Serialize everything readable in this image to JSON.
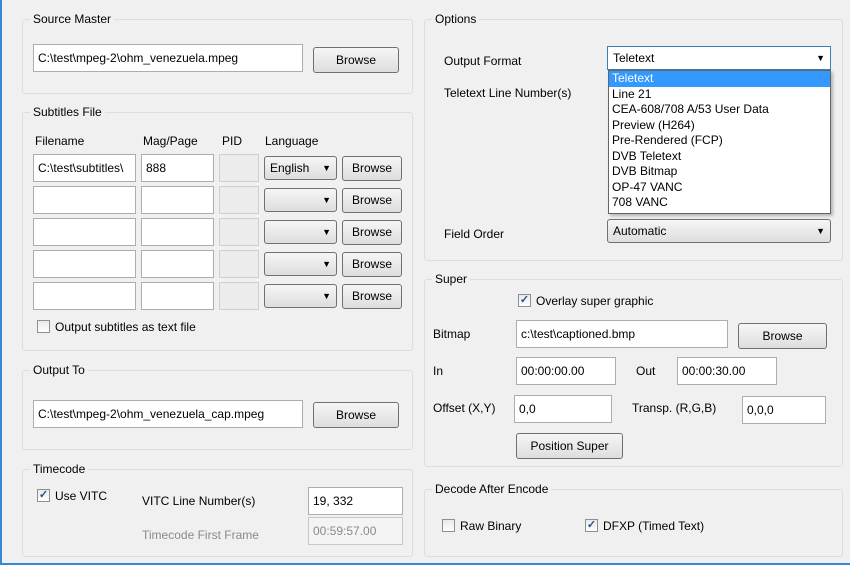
{
  "source_master": {
    "title": "Source Master",
    "path": "C:\\test\\mpeg-2\\ohm_venezuela.mpeg",
    "browse": "Browse"
  },
  "subtitles": {
    "title": "Subtitles File",
    "headers": {
      "filename": "Filename",
      "mag_page": "Mag/Page",
      "pid": "PID",
      "language": "Language"
    },
    "rows": [
      {
        "filename": "C:\\test\\subtitles\\",
        "mag_page": "888",
        "language": "English"
      },
      {
        "filename": "",
        "mag_page": "",
        "language": ""
      },
      {
        "filename": "",
        "mag_page": "",
        "language": ""
      },
      {
        "filename": "",
        "mag_page": "",
        "language": ""
      },
      {
        "filename": "",
        "mag_page": "",
        "language": ""
      }
    ],
    "browse": "Browse",
    "output_text_label": "Output subtitles as text file",
    "output_text_checked": false
  },
  "output_to": {
    "title": "Output To",
    "path": "C:\\test\\mpeg-2\\ohm_venezuela_cap.mpeg",
    "browse": "Browse"
  },
  "timecode": {
    "title": "Timecode",
    "use_vitc_label": "Use VITC",
    "use_vitc_checked": true,
    "vitc_line_label": "VITC Line Number(s)",
    "vitc_line_value": "19, 332",
    "first_frame_label": "Timecode First Frame",
    "first_frame_value": "00:59:57.00"
  },
  "options": {
    "title": "Options",
    "output_format_label": "Output Format",
    "output_format_value": "Teletext",
    "teletext_line_label": "Teletext Line Number(s)",
    "field_order_label": "Field Order",
    "field_order_value": "Automatic",
    "format_options": [
      "Teletext",
      "Line 21",
      "CEA-608/708 A/53 User Data",
      "Preview (H264)",
      "Pre-Rendered (FCP)",
      "DVB Teletext",
      "DVB Bitmap",
      "OP-47 VANC",
      "708 VANC"
    ],
    "selected_index": 0
  },
  "super": {
    "title": "Super",
    "overlay_label": "Overlay super graphic",
    "overlay_checked": true,
    "bitmap_label": "Bitmap",
    "bitmap_value": "c:\\test\\captioned.bmp",
    "browse": "Browse",
    "in_label": "In",
    "in_value": "00:00:00.00",
    "out_label": "Out",
    "out_value": "00:00:30.00",
    "offset_label": "Offset (X,Y)",
    "offset_value": "0,0",
    "transp_label": "Transp. (R,G,B)",
    "transp_value": "0,0,0",
    "position_button": "Position Super"
  },
  "decode": {
    "title": "Decode After Encode",
    "raw_label": "Raw Binary",
    "raw_checked": false,
    "dfxp_label": "DFXP (Timed Text)",
    "dfxp_checked": true
  },
  "colors": {
    "accent": "#3399ff",
    "edge": "#3a86d6",
    "border": "#d5dfe5"
  },
  "icons": {
    "dropdown": "chevron-down-icon",
    "check": "checkmark-icon"
  }
}
